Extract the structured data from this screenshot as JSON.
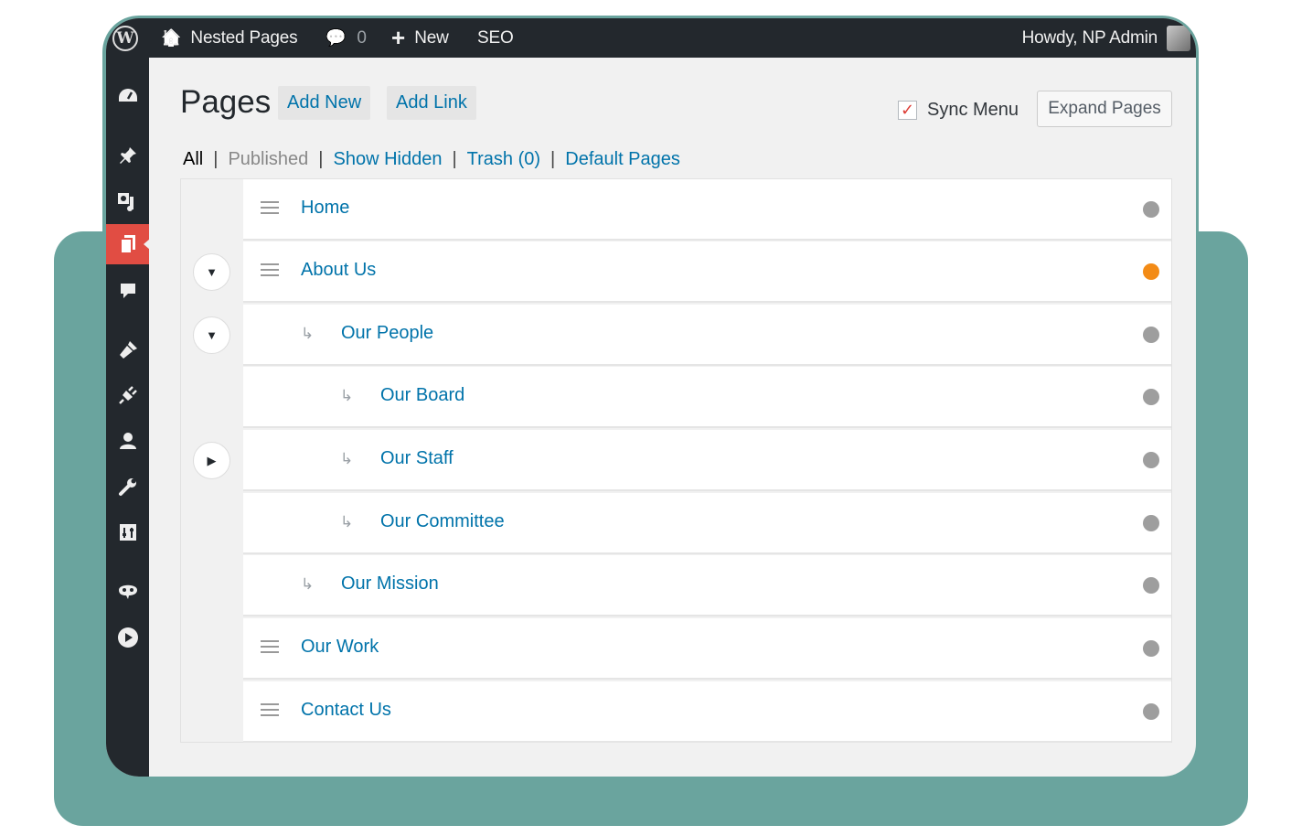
{
  "adminbar": {
    "site_name": "Nested Pages",
    "comments_count": "0",
    "new_label": "New",
    "seo_label": "SEO",
    "howdy": "Howdy, NP Admin"
  },
  "sidebar": {
    "icons": [
      "dashboard-icon",
      "pin-icon",
      "media-icon",
      "pages-icon",
      "comments-icon",
      "appearance-icon",
      "plugins-icon",
      "users-icon",
      "tools-icon",
      "settings-icon",
      "seo-icon",
      "play-icon"
    ],
    "active": "pages-icon"
  },
  "header": {
    "title": "Pages",
    "add_new": "Add New",
    "add_link": "Add Link",
    "sync_menu": "Sync Menu",
    "sync_checked": true,
    "expand_pages": "Expand Pages"
  },
  "filters": {
    "all": "All",
    "published": "Published",
    "show_hidden": "Show Hidden",
    "trash": "Trash (0)",
    "default_pages": "Default Pages",
    "separator": "|"
  },
  "pages": [
    {
      "title": "Home",
      "level": 0,
      "toggle": "none",
      "status_color": "#9e9e9e"
    },
    {
      "title": "About Us",
      "level": 0,
      "toggle": "expanded",
      "status_color": "#f38b16"
    },
    {
      "title": "Our People",
      "level": 1,
      "toggle": "expanded",
      "status_color": "#9e9e9e"
    },
    {
      "title": "Our Board",
      "level": 2,
      "toggle": "none",
      "status_color": "#9e9e9e"
    },
    {
      "title": "Our Staff",
      "level": 2,
      "toggle": "collapsed",
      "status_color": "#9e9e9e"
    },
    {
      "title": "Our Committee",
      "level": 2,
      "toggle": "none",
      "status_color": "#9e9e9e"
    },
    {
      "title": "Our Mission",
      "level": 1,
      "toggle": "none",
      "status_color": "#9e9e9e"
    },
    {
      "title": "Our Work",
      "level": 0,
      "toggle": "none",
      "status_color": "#9e9e9e"
    },
    {
      "title": "Contact Us",
      "level": 0,
      "toggle": "none",
      "status_color": "#9e9e9e"
    }
  ],
  "glyphs": {
    "home": "🏠",
    "comment": "💬",
    "plus": "+",
    "check": "✓",
    "child_arrow": "↳",
    "triangle_down": "▼",
    "triangle_right": "▶"
  }
}
